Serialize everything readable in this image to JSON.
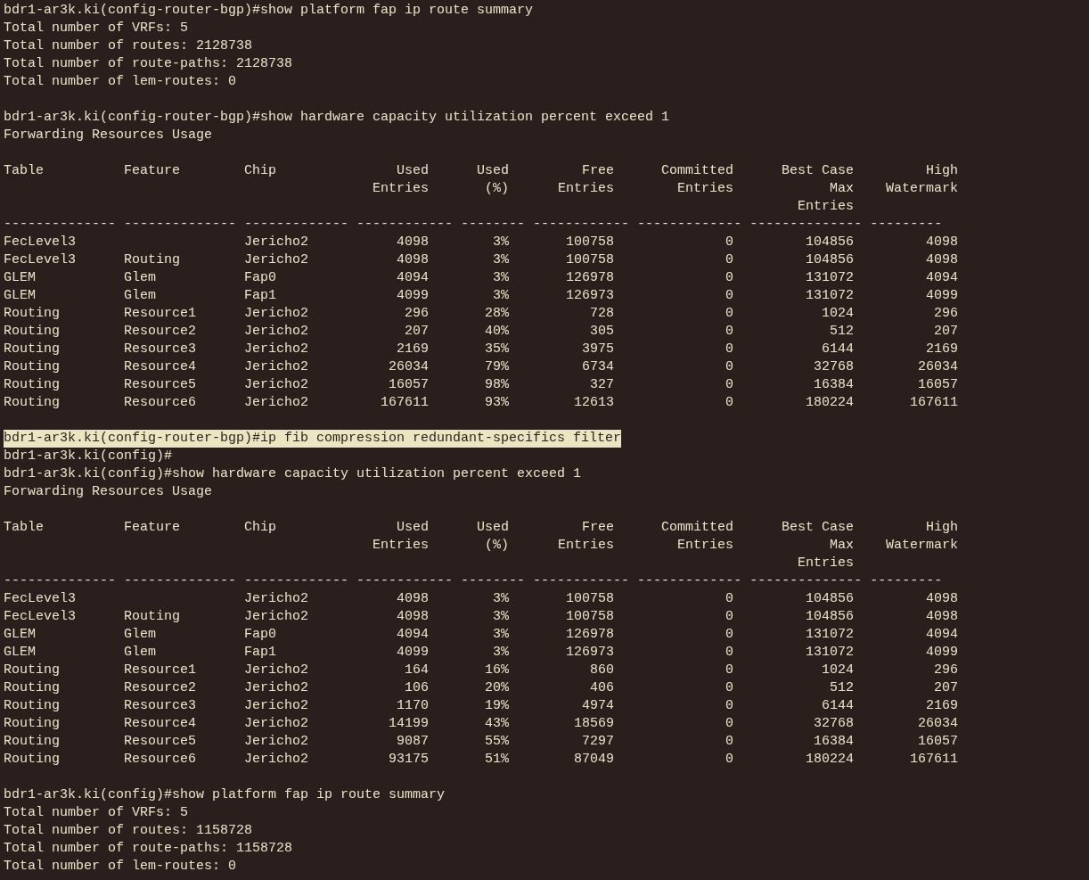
{
  "terminal": {
    "lines": [
      {
        "kind": "prompt",
        "text": "bdr1-ar3k.ki(config-router-bgp)#show platform fap ip route summary",
        "highlighted": false
      },
      {
        "kind": "output",
        "text": "Total number of VRFs: 5"
      },
      {
        "kind": "output",
        "text": "Total number of routes: 2128738"
      },
      {
        "kind": "output",
        "text": "Total number of route-paths: 2128738"
      },
      {
        "kind": "output",
        "text": "Total number of lem-routes: 0"
      },
      {
        "kind": "blank"
      },
      {
        "kind": "prompt",
        "text": "bdr1-ar3k.ki(config-router-bgp)#show hardware capacity utilization percent exceed 1",
        "highlighted": false
      },
      {
        "kind": "output",
        "text": "Forwarding Resources Usage"
      },
      {
        "kind": "blank"
      },
      {
        "kind": "table",
        "columns": [
          {
            "header": [
              "Table"
            ],
            "kind": "text"
          },
          {
            "header": [
              "Feature"
            ],
            "kind": "text"
          },
          {
            "header": [
              "Chip"
            ],
            "kind": "text"
          },
          {
            "header": [
              "Used",
              "Entries"
            ],
            "kind": "number"
          },
          {
            "header": [
              "Used",
              "(%)"
            ],
            "kind": "number"
          },
          {
            "header": [
              "Free",
              "Entries"
            ],
            "kind": "number"
          },
          {
            "header": [
              "Committed",
              "Entries"
            ],
            "kind": "number"
          },
          {
            "header": [
              "Best Case",
              "Max",
              "Entries"
            ],
            "kind": "number"
          },
          {
            "header": [
              "High",
              "Watermark"
            ],
            "kind": "number"
          }
        ],
        "rule": "-------------- -------------- ------------- ------------ -------- ------------ ------------- -------------- ---------",
        "rows": [
          [
            "FecLevel3",
            null,
            "Jericho2",
            "4098",
            "3%",
            "100758",
            "0",
            "104856",
            "4098"
          ],
          [
            "FecLevel3",
            "Routing",
            "Jericho2",
            "4098",
            "3%",
            "100758",
            "0",
            "104856",
            "4098"
          ],
          [
            "GLEM",
            "Glem",
            "Fap0",
            "4094",
            "3%",
            "126978",
            "0",
            "131072",
            "4094"
          ],
          [
            "GLEM",
            "Glem",
            "Fap1",
            "4099",
            "3%",
            "126973",
            "0",
            "131072",
            "4099"
          ],
          [
            "Routing",
            "Resource1",
            "Jericho2",
            "296",
            "28%",
            "728",
            "0",
            "1024",
            "296"
          ],
          [
            "Routing",
            "Resource2",
            "Jericho2",
            "207",
            "40%",
            "305",
            "0",
            "512",
            "207"
          ],
          [
            "Routing",
            "Resource3",
            "Jericho2",
            "2169",
            "35%",
            "3975",
            "0",
            "6144",
            "2169"
          ],
          [
            "Routing",
            "Resource4",
            "Jericho2",
            "26034",
            "79%",
            "6734",
            "0",
            "32768",
            "26034"
          ],
          [
            "Routing",
            "Resource5",
            "Jericho2",
            "16057",
            "98%",
            "327",
            "0",
            "16384",
            "16057"
          ],
          [
            "Routing",
            "Resource6",
            "Jericho2",
            "167611",
            "93%",
            "12613",
            "0",
            "180224",
            "167611"
          ]
        ]
      },
      {
        "kind": "blank"
      },
      {
        "kind": "prompt",
        "text": "bdr1-ar3k.ki(config-router-bgp)#ip fib compression redundant-specifics filter",
        "highlighted": true
      },
      {
        "kind": "prompt",
        "text": "bdr1-ar3k.ki(config)#",
        "highlighted": false
      },
      {
        "kind": "prompt",
        "text": "bdr1-ar3k.ki(config)#show hardware capacity utilization percent exceed 1",
        "highlighted": false
      },
      {
        "kind": "output",
        "text": "Forwarding Resources Usage"
      },
      {
        "kind": "blank"
      },
      {
        "kind": "table",
        "columns": [
          {
            "header": [
              "Table"
            ],
            "kind": "text"
          },
          {
            "header": [
              "Feature"
            ],
            "kind": "text"
          },
          {
            "header": [
              "Chip"
            ],
            "kind": "text"
          },
          {
            "header": [
              "Used",
              "Entries"
            ],
            "kind": "number"
          },
          {
            "header": [
              "Used",
              "(%)"
            ],
            "kind": "number"
          },
          {
            "header": [
              "Free",
              "Entries"
            ],
            "kind": "number"
          },
          {
            "header": [
              "Committed",
              "Entries"
            ],
            "kind": "number"
          },
          {
            "header": [
              "Best Case",
              "Max",
              "Entries"
            ],
            "kind": "number"
          },
          {
            "header": [
              "High",
              "Watermark"
            ],
            "kind": "number"
          }
        ],
        "rule": "-------------- -------------- ------------- ------------ -------- ------------ ------------- -------------- ---------",
        "rows": [
          [
            "FecLevel3",
            null,
            "Jericho2",
            "4098",
            "3%",
            "100758",
            "0",
            "104856",
            "4098"
          ],
          [
            "FecLevel3",
            "Routing",
            "Jericho2",
            "4098",
            "3%",
            "100758",
            "0",
            "104856",
            "4098"
          ],
          [
            "GLEM",
            "Glem",
            "Fap0",
            "4094",
            "3%",
            "126978",
            "0",
            "131072",
            "4094"
          ],
          [
            "GLEM",
            "Glem",
            "Fap1",
            "4099",
            "3%",
            "126973",
            "0",
            "131072",
            "4099"
          ],
          [
            "Routing",
            "Resource1",
            "Jericho2",
            "164",
            "16%",
            "860",
            "0",
            "1024",
            "296"
          ],
          [
            "Routing",
            "Resource2",
            "Jericho2",
            "106",
            "20%",
            "406",
            "0",
            "512",
            "207"
          ],
          [
            "Routing",
            "Resource3",
            "Jericho2",
            "1170",
            "19%",
            "4974",
            "0",
            "6144",
            "2169"
          ],
          [
            "Routing",
            "Resource4",
            "Jericho2",
            "14199",
            "43%",
            "18569",
            "0",
            "32768",
            "26034"
          ],
          [
            "Routing",
            "Resource5",
            "Jericho2",
            "9087",
            "55%",
            "7297",
            "0",
            "16384",
            "16057"
          ],
          [
            "Routing",
            "Resource6",
            "Jericho2",
            "93175",
            "51%",
            "87049",
            "0",
            "180224",
            "167611"
          ]
        ]
      },
      {
        "kind": "blank"
      },
      {
        "kind": "prompt",
        "text": "bdr1-ar3k.ki(config)#show platform fap ip route summary",
        "highlighted": false
      },
      {
        "kind": "output",
        "text": "Total number of VRFs: 5"
      },
      {
        "kind": "output",
        "text": "Total number of routes: 1158728"
      },
      {
        "kind": "output",
        "text": "Total number of route-paths: 1158728"
      },
      {
        "kind": "output",
        "text": "Total number of lem-routes: 0"
      }
    ]
  }
}
